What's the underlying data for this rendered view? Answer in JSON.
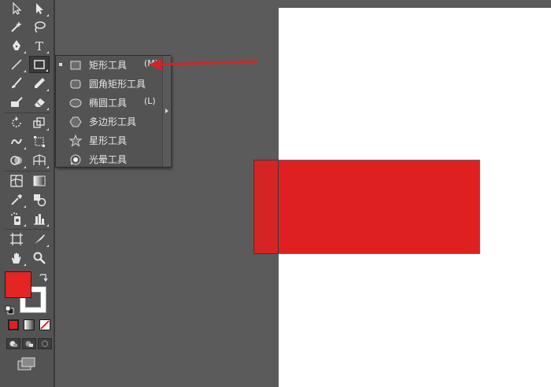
{
  "colors": {
    "fill": "#e52424",
    "shape": "#de2020",
    "canvas": "#ffffff",
    "panel": "#535353",
    "pasteboard": "#5b5b5b",
    "arrow": "#d42424"
  },
  "toolbar": {
    "tools": [
      {
        "name": "selection-tool",
        "icon": "selection-arrow-icon"
      },
      {
        "name": "direct-selection-tool",
        "icon": "direct-selection-icon"
      },
      {
        "name": "magic-wand-tool",
        "icon": "magic-wand-icon"
      },
      {
        "name": "lasso-tool",
        "icon": "lasso-icon"
      },
      {
        "name": "pen-tool",
        "icon": "pen-icon"
      },
      {
        "name": "type-tool",
        "icon": "type-icon",
        "label": "T"
      },
      {
        "name": "line-segment-tool",
        "icon": "line-icon"
      },
      {
        "name": "rectangle-tool",
        "icon": "rectangle-icon",
        "active": true
      },
      {
        "name": "paintbrush-tool",
        "icon": "paintbrush-icon"
      },
      {
        "name": "pencil-tool",
        "icon": "pencil-icon"
      },
      {
        "name": "blob-brush-tool",
        "icon": "blob-brush-icon"
      },
      {
        "name": "eraser-tool",
        "icon": "eraser-icon"
      },
      {
        "name": "rotate-tool",
        "icon": "rotate-icon"
      },
      {
        "name": "scale-tool",
        "icon": "scale-icon"
      },
      {
        "name": "warp-tool",
        "icon": "warp-icon"
      },
      {
        "name": "free-transform-tool",
        "icon": "free-transform-icon"
      },
      {
        "name": "shape-builder-tool",
        "icon": "shape-builder-icon"
      },
      {
        "name": "perspective-grid-tool",
        "icon": "perspective-grid-icon"
      },
      {
        "name": "mesh-tool",
        "icon": "mesh-icon"
      },
      {
        "name": "gradient-tool",
        "icon": "gradient-icon"
      },
      {
        "name": "eyedropper-tool",
        "icon": "eyedropper-icon"
      },
      {
        "name": "blend-tool",
        "icon": "blend-icon"
      },
      {
        "name": "symbol-sprayer-tool",
        "icon": "symbol-sprayer-icon"
      },
      {
        "name": "column-graph-tool",
        "icon": "column-graph-icon"
      },
      {
        "name": "artboard-tool",
        "icon": "artboard-icon"
      },
      {
        "name": "slice-tool",
        "icon": "slice-icon"
      },
      {
        "name": "hand-tool",
        "icon": "hand-icon"
      },
      {
        "name": "zoom-tool",
        "icon": "zoom-icon"
      }
    ]
  },
  "flyout": {
    "items": [
      {
        "label": "矩形工具",
        "key": "(M)",
        "icon": "rectangle-icon",
        "selected": true
      },
      {
        "label": "圆角矩形工具",
        "key": "",
        "icon": "rounded-rectangle-icon"
      },
      {
        "label": "椭圆工具",
        "key": "(L)",
        "icon": "ellipse-icon"
      },
      {
        "label": "多边形工具",
        "key": "",
        "icon": "polygon-icon"
      },
      {
        "label": "星形工具",
        "key": "",
        "icon": "star-icon"
      },
      {
        "label": "光晕工具",
        "key": "",
        "icon": "flare-icon"
      }
    ]
  }
}
